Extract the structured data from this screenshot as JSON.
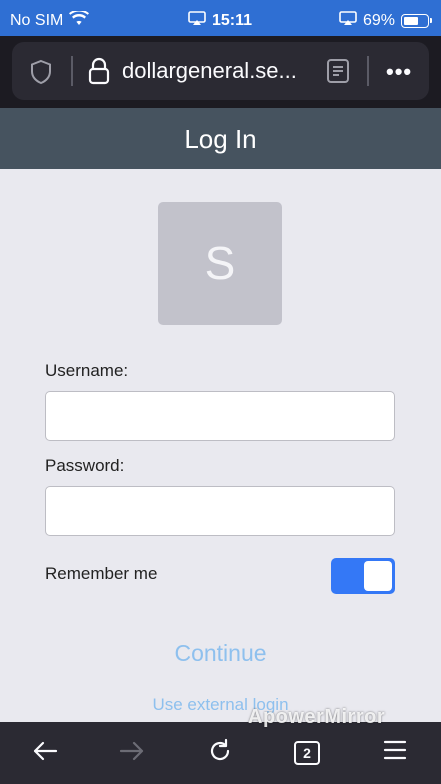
{
  "status_bar": {
    "carrier": "No SIM",
    "time": "15:11",
    "battery_percent_label": "69%",
    "battery_level": 0.69
  },
  "browser": {
    "url": "dollargeneral.se...",
    "tabs_count": "2"
  },
  "header": {
    "title": "Log In"
  },
  "avatar": {
    "initial": "S"
  },
  "form": {
    "username_label": "Username:",
    "username_value": "",
    "password_label": "Password:",
    "password_value": "",
    "remember_label": "Remember me",
    "remember_on": true,
    "continue_label": "Continue",
    "external_login_label": "Use external login"
  },
  "watermark": "ApowerMirror",
  "colors": {
    "status_bar": "#2f6fd3",
    "header": "#46535f",
    "toggle_on": "#3478f6",
    "link": "#8ec0ee"
  }
}
